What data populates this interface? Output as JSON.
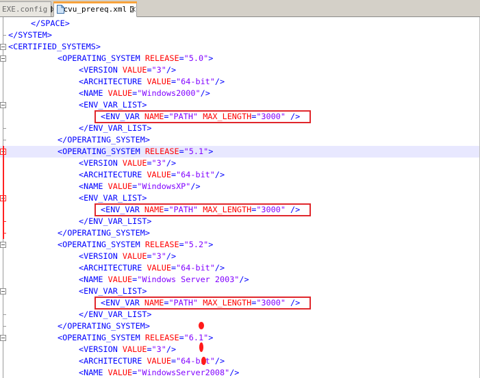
{
  "tabs": [
    {
      "label": "EXE.config",
      "active": false,
      "icon": "file-icon"
    },
    {
      "label": "cvu_prereq.xml",
      "active": true,
      "icon": "file-icon"
    }
  ],
  "lines": [
    {
      "indent": 1,
      "parts": [
        [
          "t",
          "</SPACE>"
        ]
      ]
    },
    {
      "indent": 0,
      "parts": [
        [
          "t",
          "</SYSTEM>"
        ]
      ]
    },
    {
      "indent": 0,
      "parts": [
        [
          "t",
          "<CERTIFIED_SYSTEMS>"
        ]
      ]
    },
    {
      "indent": 2,
      "parts": [
        [
          "t",
          "<OPERATING_SYSTEM "
        ],
        [
          "an",
          "RELEASE"
        ],
        [
          "t",
          "="
        ],
        [
          "av",
          "\"5.0\""
        ],
        [
          "t",
          ">"
        ]
      ]
    },
    {
      "indent": 3,
      "parts": [
        [
          "t",
          "<VERSION "
        ],
        [
          "an",
          "VALUE"
        ],
        [
          "t",
          "="
        ],
        [
          "av",
          "\"3\""
        ],
        [
          "t",
          "/>"
        ]
      ]
    },
    {
      "indent": 3,
      "parts": [
        [
          "t",
          "<ARCHITECTURE "
        ],
        [
          "an",
          "VALUE"
        ],
        [
          "t",
          "="
        ],
        [
          "av",
          "\"64-bit\""
        ],
        [
          "t",
          "/>"
        ]
      ]
    },
    {
      "indent": 3,
      "parts": [
        [
          "t",
          "<NAME "
        ],
        [
          "an",
          "VALUE"
        ],
        [
          "t",
          "="
        ],
        [
          "av",
          "\"Windows2000\""
        ],
        [
          "t",
          "/>"
        ]
      ]
    },
    {
      "indent": 3,
      "parts": [
        [
          "t",
          "<ENV_VAR_LIST>"
        ]
      ]
    },
    {
      "indent": 4,
      "parts": [
        [
          "t",
          "<ENV_VAR "
        ],
        [
          "an",
          "NAME"
        ],
        [
          "t",
          "="
        ],
        [
          "av",
          "\"PATH\""
        ],
        [
          "t",
          " "
        ],
        [
          "an",
          "MAX_LENGTH"
        ],
        [
          "t",
          "="
        ],
        [
          "av",
          "\"3000\""
        ],
        [
          "t",
          " />"
        ]
      ]
    },
    {
      "indent": 3,
      "parts": [
        [
          "t",
          "</ENV_VAR_LIST>"
        ]
      ]
    },
    {
      "indent": 2,
      "parts": [
        [
          "t",
          "</OPERATING_SYSTEM>"
        ]
      ]
    },
    {
      "indent": 2,
      "parts": [
        [
          "t",
          "<OPERATING_SYSTEM "
        ],
        [
          "an",
          "RELEASE"
        ],
        [
          "t",
          "="
        ],
        [
          "av",
          "\"5.1\""
        ],
        [
          "t",
          ">"
        ]
      ]
    },
    {
      "indent": 3,
      "parts": [
        [
          "t",
          "<VERSION "
        ],
        [
          "an",
          "VALUE"
        ],
        [
          "t",
          "="
        ],
        [
          "av",
          "\"3\""
        ],
        [
          "t",
          "/>"
        ]
      ]
    },
    {
      "indent": 3,
      "parts": [
        [
          "t",
          "<ARCHITECTURE "
        ],
        [
          "an",
          "VALUE"
        ],
        [
          "t",
          "="
        ],
        [
          "av",
          "\"64-bit\""
        ],
        [
          "t",
          "/>"
        ]
      ]
    },
    {
      "indent": 3,
      "parts": [
        [
          "t",
          "<NAME "
        ],
        [
          "an",
          "VALUE"
        ],
        [
          "t",
          "="
        ],
        [
          "av",
          "\"WindowsXP\""
        ],
        [
          "t",
          "/>"
        ]
      ]
    },
    {
      "indent": 3,
      "parts": [
        [
          "t",
          "<ENV_VAR_LIST>"
        ]
      ]
    },
    {
      "indent": 4,
      "parts": [
        [
          "t",
          "<ENV_VAR "
        ],
        [
          "an",
          "NAME"
        ],
        [
          "t",
          "="
        ],
        [
          "av",
          "\"PATH\""
        ],
        [
          "t",
          " "
        ],
        [
          "an",
          "MAX_LENGTH"
        ],
        [
          "t",
          "="
        ],
        [
          "av",
          "\"3000\""
        ],
        [
          "t",
          " />"
        ]
      ]
    },
    {
      "indent": 3,
      "parts": [
        [
          "t",
          "</ENV_VAR_LIST>"
        ]
      ]
    },
    {
      "indent": 2,
      "parts": [
        [
          "t",
          "</OPERATING_SYSTEM>"
        ]
      ]
    },
    {
      "indent": 2,
      "parts": [
        [
          "t",
          "<OPERATING_SYSTEM "
        ],
        [
          "an",
          "RELEASE"
        ],
        [
          "t",
          "="
        ],
        [
          "av",
          "\"5.2\""
        ],
        [
          "t",
          ">"
        ]
      ]
    },
    {
      "indent": 3,
      "parts": [
        [
          "t",
          "<VERSION "
        ],
        [
          "an",
          "VALUE"
        ],
        [
          "t",
          "="
        ],
        [
          "av",
          "\"3\""
        ],
        [
          "t",
          "/>"
        ]
      ]
    },
    {
      "indent": 3,
      "parts": [
        [
          "t",
          "<ARCHITECTURE "
        ],
        [
          "an",
          "VALUE"
        ],
        [
          "t",
          "="
        ],
        [
          "av",
          "\"64-bit\""
        ],
        [
          "t",
          "/>"
        ]
      ]
    },
    {
      "indent": 3,
      "parts": [
        [
          "t",
          "<NAME "
        ],
        [
          "an",
          "VALUE"
        ],
        [
          "t",
          "="
        ],
        [
          "av",
          "\"Windows Server 2003\""
        ],
        [
          "t",
          "/>"
        ]
      ]
    },
    {
      "indent": 3,
      "parts": [
        [
          "t",
          "<ENV_VAR_LIST>"
        ]
      ]
    },
    {
      "indent": 4,
      "parts": [
        [
          "t",
          "<ENV_VAR "
        ],
        [
          "an",
          "NAME"
        ],
        [
          "t",
          "="
        ],
        [
          "av",
          "\"PATH\""
        ],
        [
          "t",
          " "
        ],
        [
          "an",
          "MAX_LENGTH"
        ],
        [
          "t",
          "="
        ],
        [
          "av",
          "\"3000\""
        ],
        [
          "t",
          " />"
        ]
      ]
    },
    {
      "indent": 3,
      "parts": [
        [
          "t",
          "</ENV_VAR_LIST>"
        ]
      ]
    },
    {
      "indent": 2,
      "parts": [
        [
          "t",
          "</OPERATING_SYSTEM>"
        ]
      ]
    },
    {
      "indent": 2,
      "parts": [
        [
          "t",
          "<OPERATING_SYSTEM "
        ],
        [
          "an",
          "RELEASE"
        ],
        [
          "t",
          "="
        ],
        [
          "av",
          "\"6.1\""
        ],
        [
          "t",
          ">"
        ]
      ]
    },
    {
      "indent": 3,
      "parts": [
        [
          "t",
          "<VERSION "
        ],
        [
          "an",
          "VALUE"
        ],
        [
          "t",
          "="
        ],
        [
          "av",
          "\"3\""
        ],
        [
          "t",
          "/>"
        ]
      ]
    },
    {
      "indent": 3,
      "parts": [
        [
          "t",
          "<ARCHITECTURE "
        ],
        [
          "an",
          "VALUE"
        ],
        [
          "t",
          "="
        ],
        [
          "av",
          "\"64-bit\""
        ],
        [
          "t",
          "/>"
        ]
      ]
    },
    {
      "indent": 3,
      "parts": [
        [
          "t",
          "<NAME "
        ],
        [
          "an",
          "VALUE"
        ],
        [
          "t",
          "="
        ],
        [
          "av",
          "\"WindowsServer2008\""
        ],
        [
          "t",
          "/>"
        ]
      ]
    }
  ],
  "current_line": 11,
  "highlighted_lines": [
    8,
    16,
    24
  ],
  "colors": {
    "tag": "#0000ff",
    "attribute": "#ff0000",
    "value": "#8000ff",
    "highlight_box": "#e0262b",
    "current_line_bg": "#e8e8ff",
    "active_tab_accent": "#f7a23b"
  }
}
